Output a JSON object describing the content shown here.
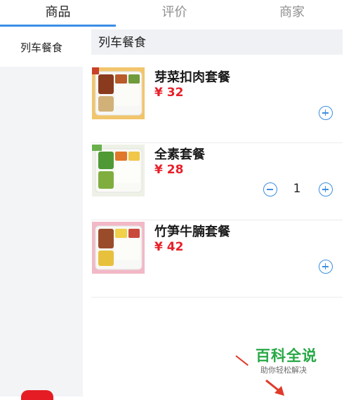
{
  "tabs": [
    {
      "label": "商品"
    },
    {
      "label": "评价"
    },
    {
      "label": "商家"
    }
  ],
  "sidebar": {
    "items": [
      {
        "label": "列车餐食"
      }
    ]
  },
  "section": {
    "title": "列车餐食"
  },
  "products": [
    {
      "name": "芽菜扣肉套餐",
      "price": "¥ 32"
    },
    {
      "name": "全素套餐",
      "price": "¥ 28",
      "quantity": "1"
    },
    {
      "name": "竹笋牛腩套餐",
      "price": "¥ 42"
    }
  ],
  "watermark": {
    "title": "百科全说",
    "subtitle": "助你轻松解决"
  },
  "colors": {
    "accent": "#3d8ee0",
    "price": "#e8202a",
    "watermark": "#27a846"
  }
}
